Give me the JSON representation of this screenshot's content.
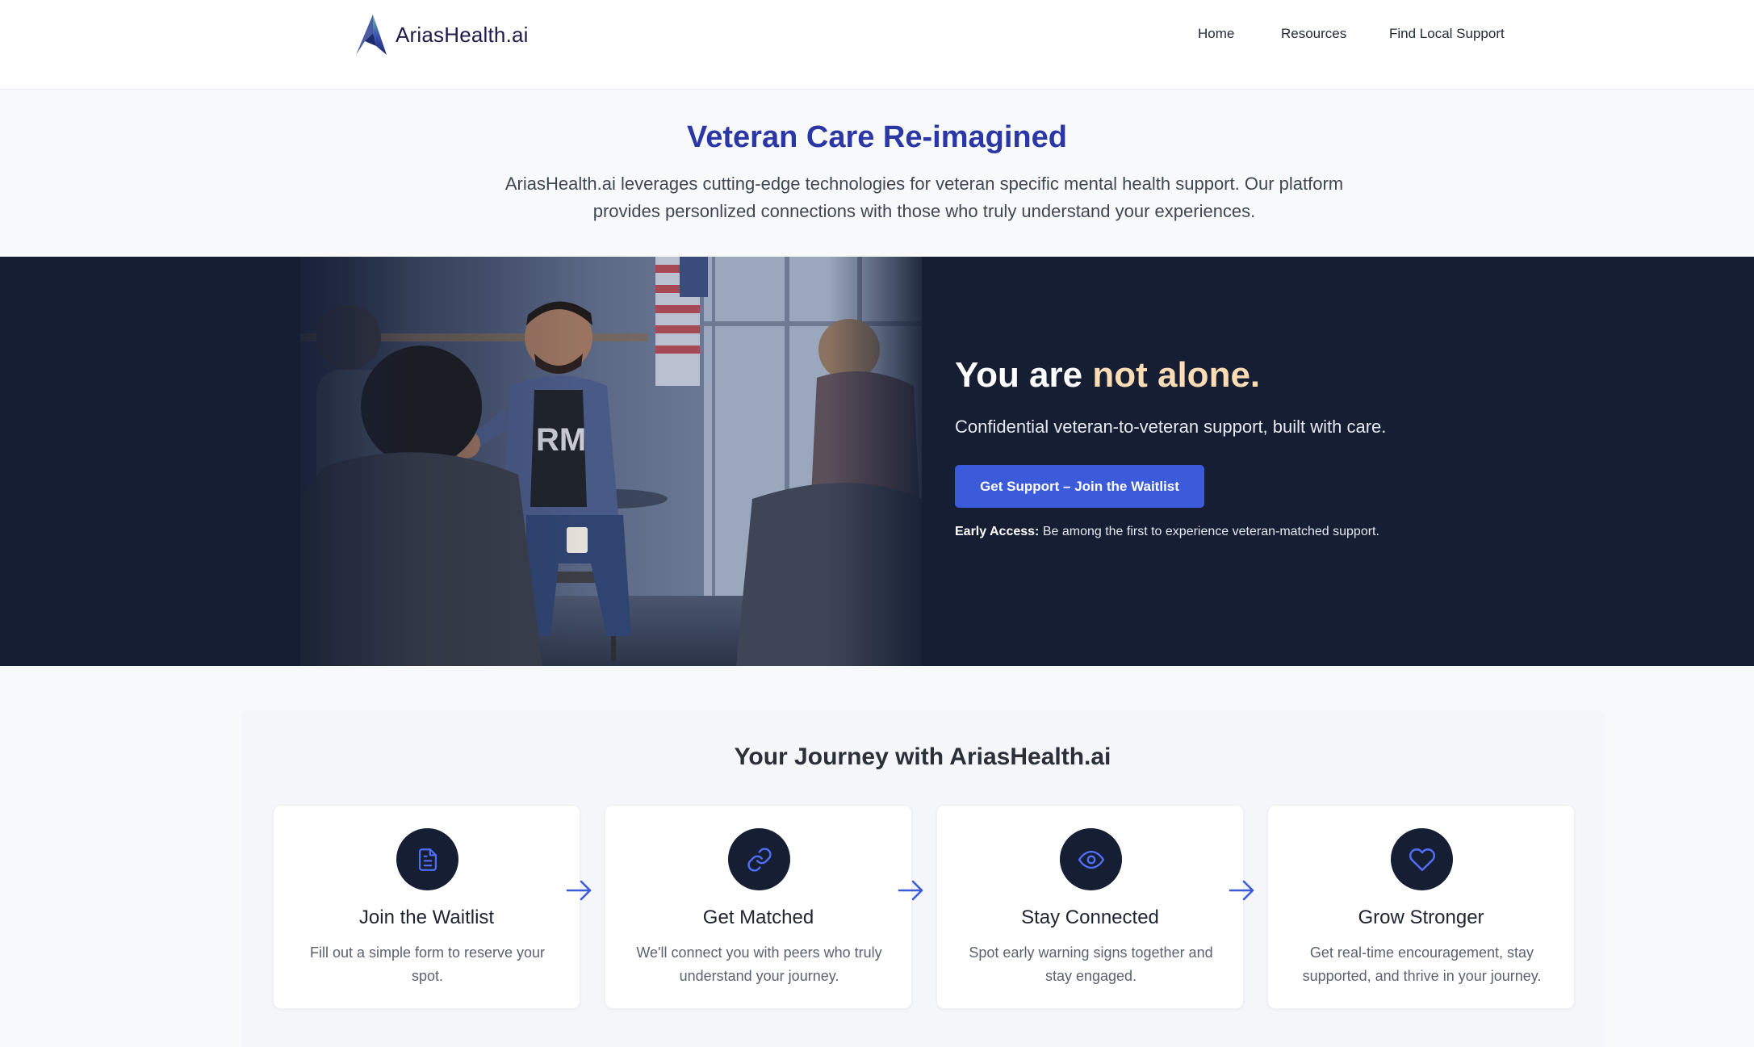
{
  "header": {
    "logo_text": "AriasHealth.ai",
    "nav": [
      "Home",
      "Resources",
      "Find Local Support"
    ]
  },
  "intro": {
    "title": "Veteran Care Re-imagined",
    "text": "AriasHealth.ai leverages cutting-edge technologies for veteran specific mental health support. Our platform provides personlized connections with those who truly understand your experiences."
  },
  "hero": {
    "title_plain": "You are ",
    "title_accent": "not alone.",
    "subtitle": "Confidential veteran-to-veteran support, built with care.",
    "cta_label": "Get Support – Join the Waitlist",
    "early_label": "Early Access:",
    "early_text": " Be among the first to experience veteran-matched support.",
    "shirt_text": "RM"
  },
  "journey": {
    "title": "Your Journey with AriasHealth.ai",
    "steps": [
      {
        "icon": "document-icon",
        "title": "Join the Waitlist",
        "text": "Fill out a simple form to reserve your spot."
      },
      {
        "icon": "link-icon",
        "title": "Get Matched",
        "text": "We'll connect you with peers who truly understand your journey."
      },
      {
        "icon": "eye-icon",
        "title": "Stay Connected",
        "text": "Spot early warning signs together and stay engaged."
      },
      {
        "icon": "heart-icon",
        "title": "Grow Stronger",
        "text": "Get real-time encouragement, stay supported, and thrive in your journey."
      }
    ]
  },
  "colors": {
    "brand_blue": "#2a37a5",
    "hero_bg": "#151e33",
    "cta": "#3b5bdb",
    "accent_peach": "#fcdcb4",
    "icon_blue": "#4f6ef7"
  }
}
